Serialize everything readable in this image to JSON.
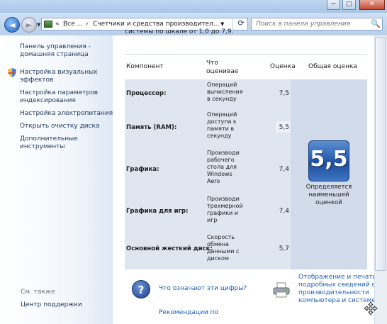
{
  "window": {
    "minimize": "─",
    "maximize": "□",
    "close": "✕"
  },
  "nav": {
    "back": "◄",
    "forward": "►",
    "recent": "▼",
    "breadcrumb": [
      "«",
      "Все ...",
      "›",
      "Счетчики и средства производител...",
      "▼"
    ],
    "refresh": "⟳",
    "search_placeholder": "Поиск в панели управления",
    "search_icon": "🔍"
  },
  "sidebar": {
    "home": [
      "Панель управления -",
      "домашняя страница"
    ],
    "items": [
      {
        "lines": [
          "Настройка визуальных",
          "эффектов"
        ],
        "icon": "shield-icon"
      },
      {
        "lines": [
          "Настройка параметров",
          "индексирования"
        ]
      },
      {
        "lines": [
          "Настройка электропитания"
        ]
      },
      {
        "lines": [
          "Открыть очистку диска"
        ]
      },
      {
        "lines": [
          "Дополнительные",
          "инструменты"
        ]
      }
    ],
    "see_also": "См. также",
    "see_also_items": [
      "Центр поддержки"
    ]
  },
  "content": {
    "top_fragment": "системы по шкале от 1,0 до 7,9.",
    "headers": {
      "component": "Компонент",
      "what": [
        "Что",
        "оцениваe"
      ],
      "score": "Оценка",
      "overall": "Общая оценка"
    },
    "rows": [
      {
        "component": "Процессор:",
        "desc": [
          "Операций",
          "вычисления",
          "в секунду"
        ],
        "score": "7,5"
      },
      {
        "component": "Память (RAM):",
        "desc": [
          "Операций",
          "доступа к",
          "памяти в",
          "секунду"
        ],
        "score": "5,5"
      },
      {
        "component": "Графика:",
        "desc": [
          "Производи",
          "рабочего",
          "стола для",
          "Windows",
          "Aero"
        ],
        "score": "7,4"
      },
      {
        "component": "Графика для игр:",
        "desc": [
          "Производи",
          "трехмерной",
          "графики и",
          "игр"
        ],
        "score": "7,4"
      },
      {
        "component": "Основной жесткий диск:",
        "desc": [
          "Скорость",
          "обмена",
          "данными с",
          "диском"
        ],
        "score": "5,7"
      }
    ],
    "overall": {
      "value": "5,5",
      "caption": [
        "Определяется",
        "наименьшей",
        "оценкой"
      ]
    },
    "links": {
      "what_numbers": "Что означают эти цифры?",
      "help_icon": "?",
      "print": [
        "Отображение и печать",
        "подробных сведений о",
        "производительности",
        "компьютера и системе"
      ],
      "recommend": [
        "Рекомендации по"
      ]
    }
  },
  "colors": {
    "link": "#1a5fb4",
    "badge": "#2a5fb0",
    "table_bg": "#dfe6f0"
  }
}
